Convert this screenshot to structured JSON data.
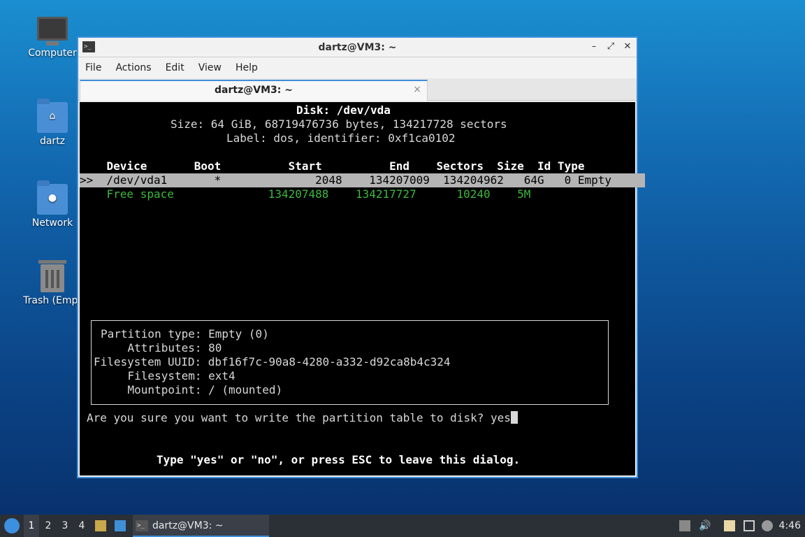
{
  "desktop": {
    "icons": [
      {
        "label": "Computer"
      },
      {
        "label": "dartz"
      },
      {
        "label": "Network"
      },
      {
        "label": "Trash (Empt"
      }
    ]
  },
  "window": {
    "title": "dartz@VM3: ~",
    "menu": [
      "File",
      "Actions",
      "Edit",
      "View",
      "Help"
    ],
    "tab_label": "dartz@VM3: ~",
    "tab_close": "×",
    "controls": {
      "minimize": "–",
      "maximize": "⤢",
      "close": "✕"
    }
  },
  "terminal": {
    "disk_line": "Disk: /dev/vda",
    "size_line": "Size: 64 GiB, 68719476736 bytes, 134217728 sectors",
    "label_line": "Label: dos, identifier: 0xf1ca0102",
    "header_row": "    Device       Boot          Start          End    Sectors  Size  Id Type",
    "selected_row": ">>  /dev/vda1       *              2048    134207009  134204962   64G   0 Empty     ",
    "free_row": "    Free space              134207488    134217727      10240    5M",
    "info": [
      "Partition type: Empty (0)",
      "    Attributes: 80",
      "Filesystem UUID: dbf16f7c-90a8-4280-a332-d92ca8b4c324",
      "    Filesystem: ext4",
      "    Mountpoint: / (mounted)"
    ],
    "prompt": "Are you sure you want to write the partition table to disk? yes",
    "hint": "Type \"yes\" or \"no\", or press ESC to leave this dialog."
  },
  "taskbar": {
    "workspaces": [
      "1",
      "2",
      "3",
      "4"
    ],
    "task_label": "dartz@VM3: ~",
    "clock": "4:46"
  }
}
